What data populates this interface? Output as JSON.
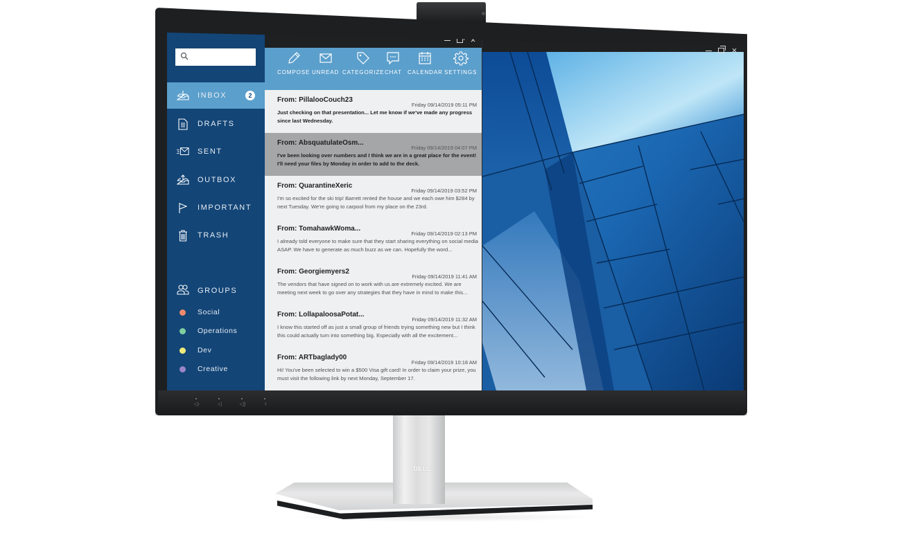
{
  "device": {
    "brand_logo": "DELL",
    "chin_buttons": [
      {
        "icon": "call-decline-icon",
        "glyph": "◁‑"
      },
      {
        "icon": "volume-down-icon",
        "glyph": "◁"
      },
      {
        "icon": "volume-up-icon",
        "glyph": "◁)"
      },
      {
        "icon": "mic-mute-icon",
        "glyph": "♀"
      }
    ]
  },
  "mail": {
    "search": {
      "placeholder": "",
      "value": ""
    },
    "window_controls": {
      "minimize": "minimize",
      "restore": "restore",
      "close": "×"
    },
    "toolbar": [
      {
        "id": "compose",
        "label": "COMPOSE",
        "icon": "pencil-icon"
      },
      {
        "id": "unread",
        "label": "UNREAD",
        "icon": "envelope-icon"
      },
      {
        "id": "categorize",
        "label": "CATEGORIZE",
        "icon": "tag-icon"
      },
      {
        "id": "chat",
        "label": "CHAT",
        "icon": "chat-bubble-icon"
      },
      {
        "id": "calendar",
        "label": "CALENDAR",
        "icon": "calendar-icon"
      },
      {
        "id": "settings",
        "label": "SETTINGS",
        "icon": "gear-icon"
      }
    ],
    "folders": [
      {
        "id": "inbox",
        "label": "INBOX",
        "icon": "inbox-download-icon",
        "badge": "2",
        "active": true
      },
      {
        "id": "drafts",
        "label": "DRAFTS",
        "icon": "document-icon"
      },
      {
        "id": "sent",
        "label": "SENT",
        "icon": "send-envelope-icon"
      },
      {
        "id": "outbox",
        "label": "OUTBOX",
        "icon": "outbox-upload-icon"
      },
      {
        "id": "important",
        "label": "IMPORTANT",
        "icon": "flag-icon"
      },
      {
        "id": "trash",
        "label": "TRASH",
        "icon": "trash-icon"
      }
    ],
    "groups": {
      "label": "GROUPS",
      "icon": "users-icon",
      "items": [
        {
          "label": "Social",
          "color": "#f08a6e"
        },
        {
          "label": "Operations",
          "color": "#7fcf9e"
        },
        {
          "label": "Dev",
          "color": "#f0ea7a"
        },
        {
          "label": "Creative",
          "color": "#9a86c6"
        }
      ]
    },
    "messages": [
      {
        "from": "From: PillalooCouch23",
        "date": "Friday 09/14/2019 05:11 PM",
        "body": "Just checking on that presentation... Let me know if we've made any progress since last Wednesday.",
        "unread": true,
        "selected": false
      },
      {
        "from": "From: AbsquatulateOsm...",
        "date": "Friday 09/14/2019 04:07 PM",
        "body": "I've been looking over numbers and I think we are in a great place for the event! I'll need your files by Monday in order to add to the deck.",
        "unread": true,
        "selected": true
      },
      {
        "from": "From: QuarantineXeric",
        "date": "Friday 09/14/2019 03:52 PM",
        "body": "I'm so excited for the ski trip! Barrett rented the house and we each owe him $284 by next Tuesday. We're going to carpool from my place on the 23rd.",
        "unread": false,
        "selected": false
      },
      {
        "from": "From: TomahawkWoma...",
        "date": "Friday 09/14/2019 02:13 PM",
        "body": "I already told everyone to make sure that they start sharing everything on social media ASAP. We have to generate as much buzz as we can. Hopefully the word...",
        "unread": false,
        "selected": false
      },
      {
        "from": "From: Georgiemyers2",
        "date": "Friday 09/14/2019 11:41 AM",
        "body": "The vendors that have signed on to work with us are extremely excited. We are meeting next week to go over any strategies that they have in mind to make this...",
        "unread": false,
        "selected": false
      },
      {
        "from": "From: LollapaloosaPotat...",
        "date": "Friday 09/14/2019 11:32 AM",
        "body": "I know this started off as just a small group of friends trying something new but I think this could actually turn into something big. Especially with all the excitement...",
        "unread": false,
        "selected": false
      },
      {
        "from": "From: ARTbaglady00",
        "date": "Friday 09/14/2019 10:18 AM",
        "body": "Hi! You've been selected to win a $500 Visa gift card! In order to claim your prize, you must visit the following link by next Monday, September 17.",
        "unread": false,
        "selected": false
      }
    ]
  },
  "wallpaper_window": {
    "image": "blue-glass-building-facade",
    "window_controls": {
      "minimize": "minimize",
      "restore": "restore",
      "close": "×"
    }
  }
}
